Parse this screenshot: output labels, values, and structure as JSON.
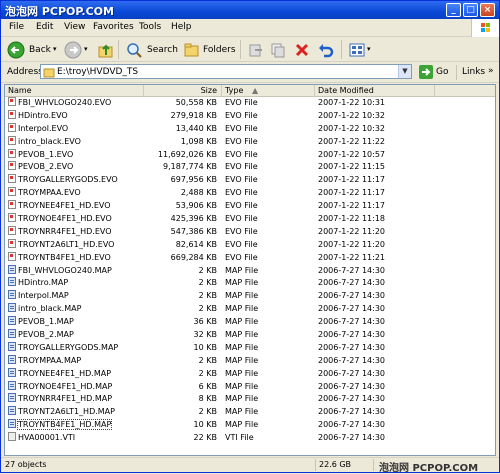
{
  "window": {
    "title_watermark": "泡泡网 PCPOP.COM",
    "minimize": "_",
    "maximize": "□",
    "close": "×"
  },
  "menu": [
    "File",
    "Edit",
    "View",
    "Favorites",
    "Tools",
    "Help"
  ],
  "toolbar": {
    "back": "Back",
    "search": "Search",
    "folders": "Folders",
    "views_arrow": "▾"
  },
  "address": {
    "label": "Address",
    "path": "E:\\troy\\HVDVD_TS",
    "go": "Go",
    "links": "Links",
    "links_arrow": "»"
  },
  "columns": {
    "name": "Name",
    "size": "Size",
    "type": "Type",
    "sort_marker": "▲",
    "date": "Date Modified"
  },
  "files": [
    {
      "name": "FBI_WHVLOGO240.EVO",
      "size": "50,558 KB",
      "type": "EVO File",
      "date": "2007-1-22 10:31",
      "icon": "evo"
    },
    {
      "name": "HDintro.EVO",
      "size": "279,918 KB",
      "type": "EVO File",
      "date": "2007-1-22 10:32",
      "icon": "evo"
    },
    {
      "name": "Interpol.EVO",
      "size": "13,440 KB",
      "type": "EVO File",
      "date": "2007-1-22 10:32",
      "icon": "evo"
    },
    {
      "name": "intro_black.EVO",
      "size": "1,098 KB",
      "type": "EVO File",
      "date": "2007-1-22 11:22",
      "icon": "evo"
    },
    {
      "name": "PEVOB_1.EVO",
      "size": "11,692,026 KB",
      "type": "EVO File",
      "date": "2007-1-22 10:57",
      "icon": "evo"
    },
    {
      "name": "PEVOB_2.EVO",
      "size": "9,187,774 KB",
      "type": "EVO File",
      "date": "2007-1-22 11:15",
      "icon": "evo"
    },
    {
      "name": "TROYGALLERYGODS.EVO",
      "size": "697,956 KB",
      "type": "EVO File",
      "date": "2007-1-22 11:17",
      "icon": "evo"
    },
    {
      "name": "TROYMPAA.EVO",
      "size": "2,488 KB",
      "type": "EVO File",
      "date": "2007-1-22 11:17",
      "icon": "evo"
    },
    {
      "name": "TROYNEE4FE1_HD.EVO",
      "size": "53,906 KB",
      "type": "EVO File",
      "date": "2007-1-22 11:17",
      "icon": "evo"
    },
    {
      "name": "TROYNOE4FE1_HD.EVO",
      "size": "425,396 KB",
      "type": "EVO File",
      "date": "2007-1-22 11:18",
      "icon": "evo"
    },
    {
      "name": "TROYNRR4FE1_HD.EVO",
      "size": "547,386 KB",
      "type": "EVO File",
      "date": "2007-1-22 11:20",
      "icon": "evo"
    },
    {
      "name": "TROYNT2A6LT1_HD.EVO",
      "size": "82,614 KB",
      "type": "EVO File",
      "date": "2007-1-22 11:20",
      "icon": "evo"
    },
    {
      "name": "TROYNTB4FE1_HD.EVO",
      "size": "669,284 KB",
      "type": "EVO File",
      "date": "2007-1-22 11:21",
      "icon": "evo"
    },
    {
      "name": "FBI_WHVLOGO240.MAP",
      "size": "2 KB",
      "type": "MAP File",
      "date": "2006-7-27 14:30",
      "icon": "map"
    },
    {
      "name": "HDintro.MAP",
      "size": "2 KB",
      "type": "MAP File",
      "date": "2006-7-27 14:30",
      "icon": "map"
    },
    {
      "name": "Interpol.MAP",
      "size": "2 KB",
      "type": "MAP File",
      "date": "2006-7-27 14:30",
      "icon": "map"
    },
    {
      "name": "intro_black.MAP",
      "size": "2 KB",
      "type": "MAP File",
      "date": "2006-7-27 14:30",
      "icon": "map"
    },
    {
      "name": "PEVOB_1.MAP",
      "size": "36 KB",
      "type": "MAP File",
      "date": "2006-7-27 14:30",
      "icon": "map"
    },
    {
      "name": "PEVOB_2.MAP",
      "size": "32 KB",
      "type": "MAP File",
      "date": "2006-7-27 14:30",
      "icon": "map"
    },
    {
      "name": "TROYGALLERYGODS.MAP",
      "size": "10 KB",
      "type": "MAP File",
      "date": "2006-7-27 14:30",
      "icon": "map"
    },
    {
      "name": "TROYMPAA.MAP",
      "size": "2 KB",
      "type": "MAP File",
      "date": "2006-7-27 14:30",
      "icon": "map"
    },
    {
      "name": "TROYNEE4FE1_HD.MAP",
      "size": "2 KB",
      "type": "MAP File",
      "date": "2006-7-27 14:30",
      "icon": "map"
    },
    {
      "name": "TROYNOE4FE1_HD.MAP",
      "size": "6 KB",
      "type": "MAP File",
      "date": "2006-7-27 14:30",
      "icon": "map"
    },
    {
      "name": "TROYNRR4FE1_HD.MAP",
      "size": "8 KB",
      "type": "MAP File",
      "date": "2006-7-27 14:30",
      "icon": "map"
    },
    {
      "name": "TROYNT2A6LT1_HD.MAP",
      "size": "2 KB",
      "type": "MAP File",
      "date": "2006-7-27 14:30",
      "icon": "map"
    },
    {
      "name": "TROYNTB4FE1_HD.MAP",
      "size": "10 KB",
      "type": "MAP File",
      "date": "2006-7-27 14:30",
      "icon": "map"
    },
    {
      "name": "HVA00001.VTI",
      "size": "22 KB",
      "type": "VTI File",
      "date": "2006-7-27 14:30",
      "icon": "vti"
    }
  ],
  "status": {
    "objects": "27 objects",
    "size": "22.6 GB",
    "watermark": "泡泡网 PCPOP.COM"
  }
}
